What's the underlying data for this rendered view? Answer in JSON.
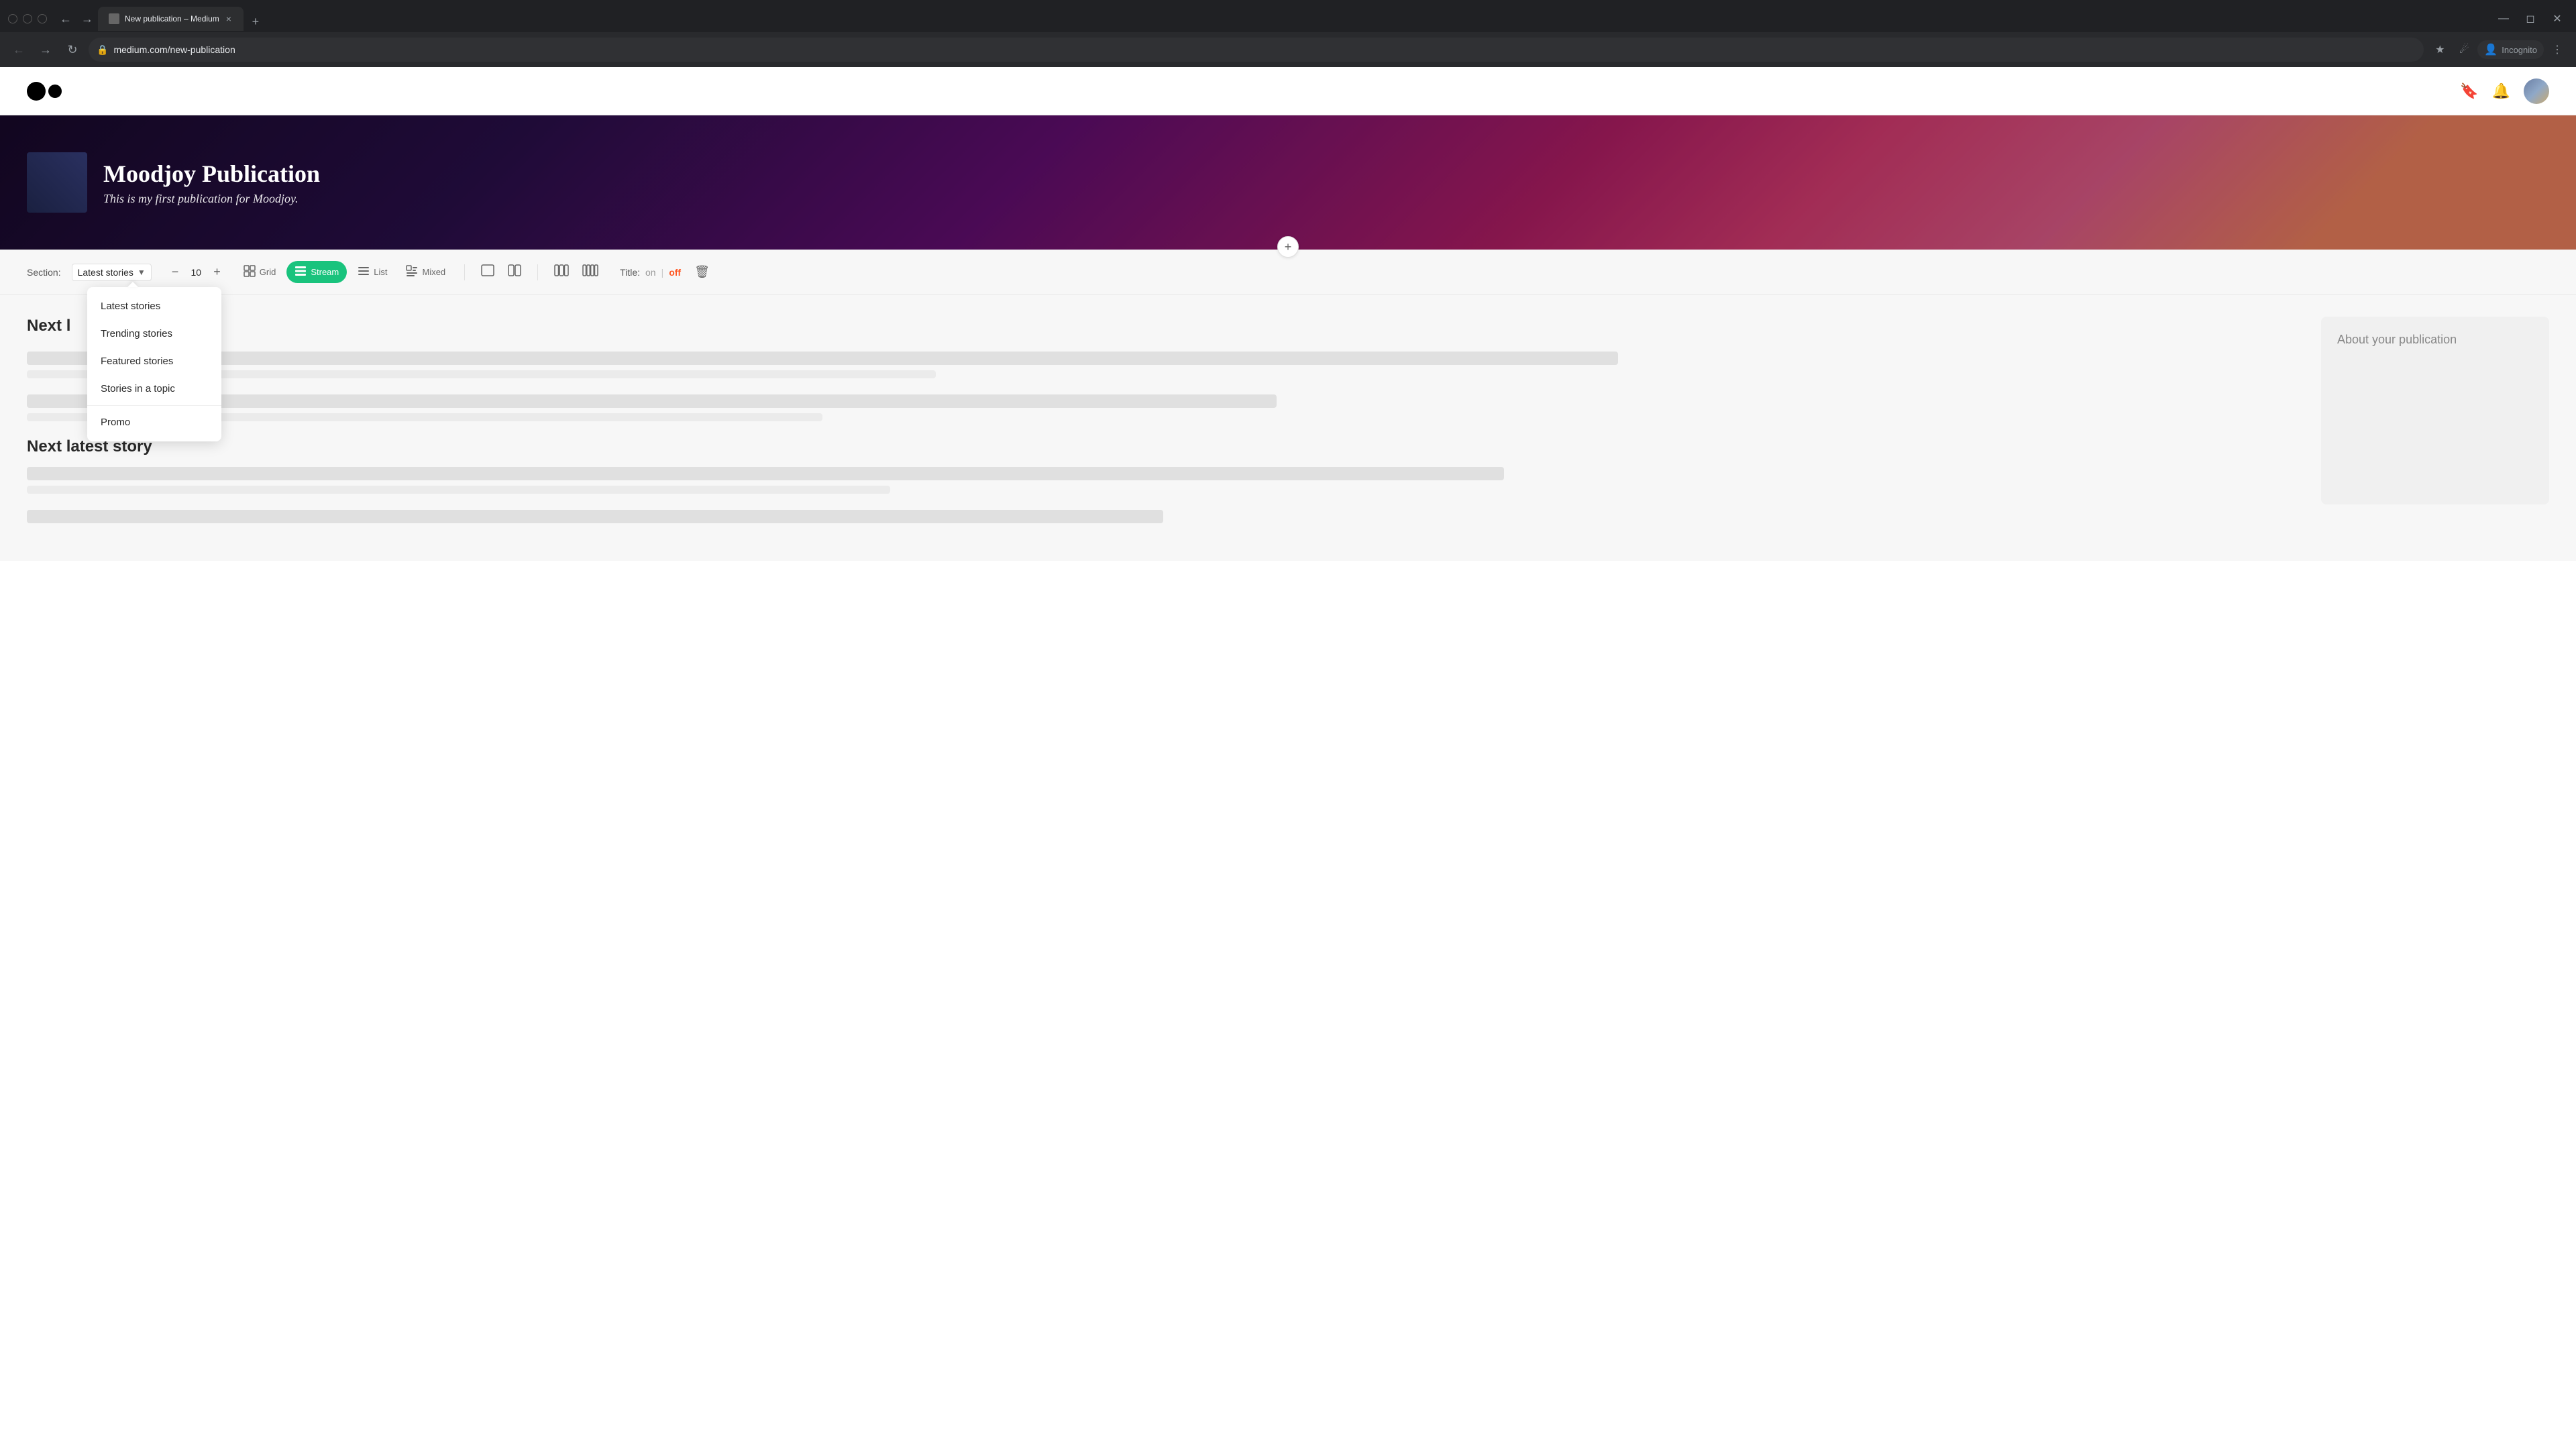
{
  "browser": {
    "tab": {
      "title": "New publication – Medium",
      "favicon": "M"
    },
    "address": "medium.com/new-publication",
    "new_tab_label": "+",
    "close_label": "×",
    "incognito_label": "Incognito"
  },
  "header": {
    "bookmark_icon": "🔖",
    "bell_icon": "🔔"
  },
  "banner": {
    "title": "Moodjoy Publication",
    "subtitle": "This is my first publication for Moodjoy."
  },
  "section_controls": {
    "add_label": "+",
    "section_label": "Section:",
    "selected_section": "Latest stories",
    "count": "10",
    "count_minus": "−",
    "count_plus": "+",
    "view_grid": "Grid",
    "view_stream": "Stream",
    "view_list": "List",
    "view_mixed": "Mixed",
    "title_label": "Title:",
    "title_on": "on",
    "title_separator": "|",
    "title_off": "off"
  },
  "dropdown": {
    "items": [
      {
        "label": "Latest stories",
        "active": true
      },
      {
        "label": "Trending stories",
        "active": false
      },
      {
        "label": "Featured stories",
        "active": false
      },
      {
        "label": "Stories in a topic",
        "active": false
      },
      {
        "label": "Promo",
        "active": false
      }
    ]
  },
  "stories": {
    "heading": "Next l",
    "next_story_heading": "Next latest story",
    "items": [
      {
        "title_width": "70%",
        "meta_width": "40%"
      },
      {
        "title_width": "55%",
        "meta_width": "35%"
      }
    ]
  },
  "sidebar": {
    "about_title": "About your publication"
  }
}
